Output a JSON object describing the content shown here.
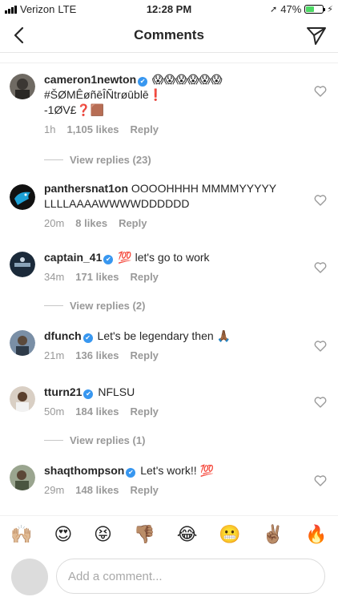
{
  "status_bar": {
    "carrier": "Verizon",
    "network": "LTE",
    "time": "12:28 PM",
    "battery": "47%",
    "battery_fraction": 0.47
  },
  "header": {
    "title": "Comments",
    "back_icon": "chevron-left-icon",
    "send_icon": "paper-plane-icon"
  },
  "comments": [
    {
      "username": "cameron1newton",
      "verified": true,
      "text": "😱😱😱😱😱😱\n#ŠØMÊøñēÎÑtrøūblē❗\n-1ØV£❓🟫",
      "age": "1h",
      "likes": "1,105 likes",
      "reply": "Reply",
      "view_replies": "View replies (23)"
    },
    {
      "username": "panthersnat1on",
      "verified": false,
      "text": "OOOOHHHH MMMMYYYYY LLLLAAAAWWWWDDDDDD",
      "age": "20m",
      "likes": "8 likes",
      "reply": "Reply"
    },
    {
      "username": "captain_41",
      "verified": true,
      "text": "💯 let's go to work",
      "age": "34m",
      "likes": "171 likes",
      "reply": "Reply",
      "view_replies": "View replies (2)"
    },
    {
      "username": "dfunch",
      "verified": true,
      "text": "Let's be legendary then 🙏🏾",
      "age": "21m",
      "likes": "136 likes",
      "reply": "Reply"
    },
    {
      "username": "tturn21",
      "verified": true,
      "text": "NFLSU",
      "age": "50m",
      "likes": "184 likes",
      "reply": "Reply",
      "view_replies": "View replies (1)"
    },
    {
      "username": "shaqthompson",
      "verified": true,
      "text": "Let's work!! 💯",
      "age": "29m",
      "likes": "148 likes",
      "reply": "Reply"
    }
  ],
  "emoji_bar": [
    "🙌🏼",
    "😍",
    "😝",
    "👎🏽",
    "😂",
    "😬",
    "✌🏽",
    "🔥"
  ],
  "composer": {
    "placeholder": "Add a comment..."
  }
}
